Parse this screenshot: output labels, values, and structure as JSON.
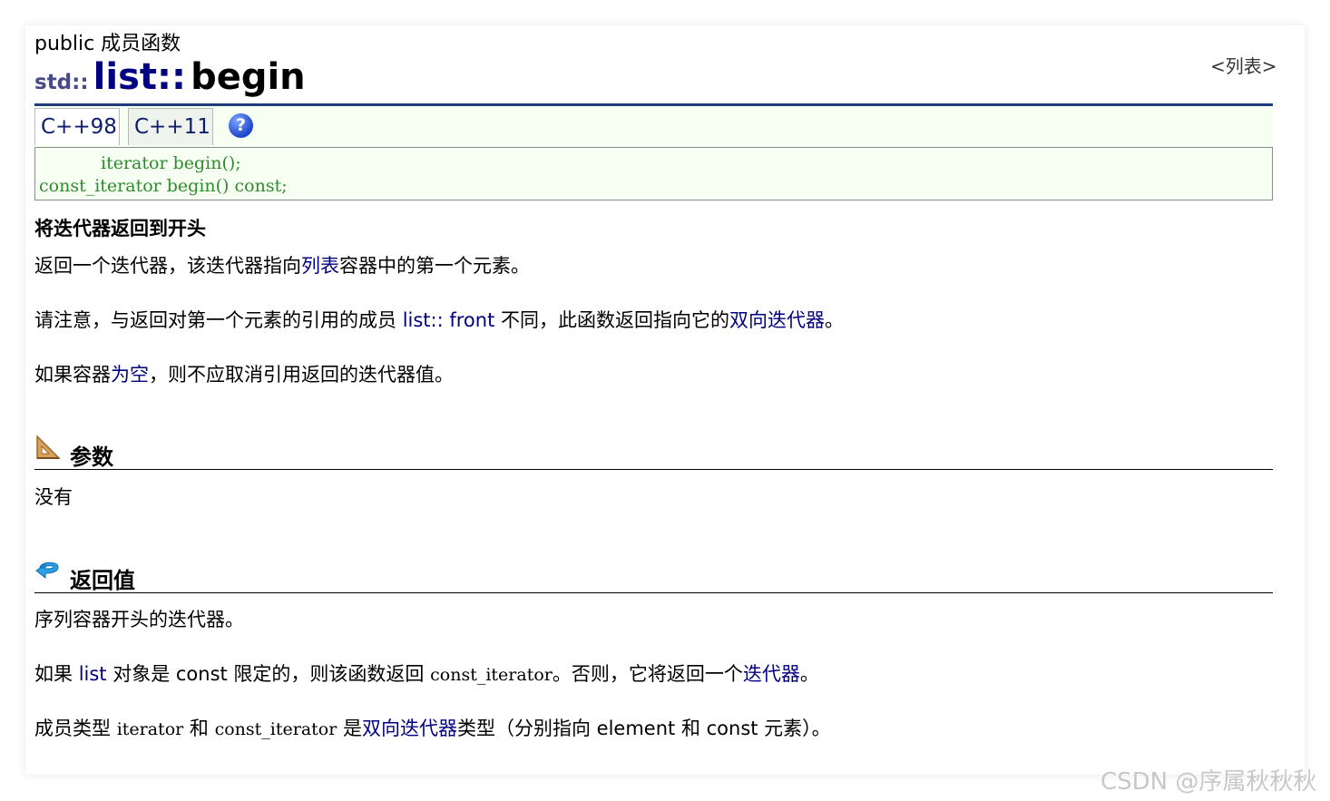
{
  "header": {
    "kind": "public 成员函数",
    "list_link": "<列表>",
    "ns": "std::",
    "class": "list::",
    "func": "begin"
  },
  "tabs": [
    "C++98",
    "C++11"
  ],
  "help_icon": "?",
  "code": {
    "line1": "iterator begin();",
    "line2": "const_iterator begin() const;"
  },
  "summary": "将迭代器返回到开头",
  "desc": {
    "p1_a": "返回一个迭代器，该迭代器指向",
    "p1_link": "列表",
    "p1_b": "容器中的第一个元素。",
    "p2_a": "请注意，与返回对第一个元素的引用的成员 ",
    "p2_link": "list:: front",
    "p2_b": " 不同，此函数返回指向它的",
    "p2_link2": "双向迭代器",
    "p2_c": "。",
    "p3_a": "如果容器",
    "p3_link": "为空",
    "p3_b": "，则不应取消引用返回的迭代器值。"
  },
  "params": {
    "title": "参数",
    "icon": "set-square-icon",
    "text": "没有"
  },
  "return": {
    "title": "返回值",
    "icon": "return-arrow-icon",
    "p1": "序列容器开头的迭代器。",
    "p2_a": "如果 ",
    "p2_link": "list",
    "p2_b": " 对象是 const 限定的，则该函数返回 ",
    "p2_code": "const_iterator",
    "p2_c": "。否则，它将返回一个",
    "p2_d": "迭代器",
    "p2_e": "。",
    "p3_a": "成员类型 ",
    "p3_code1": "iterator",
    "p3_b": " 和 ",
    "p3_code2": "const_iterator",
    "p3_c": " 是",
    "p3_link": "双向迭代器",
    "p3_d": "类型（分别指向 element 和 const 元素）。"
  },
  "watermark": "CSDN @序属秋秋秋"
}
